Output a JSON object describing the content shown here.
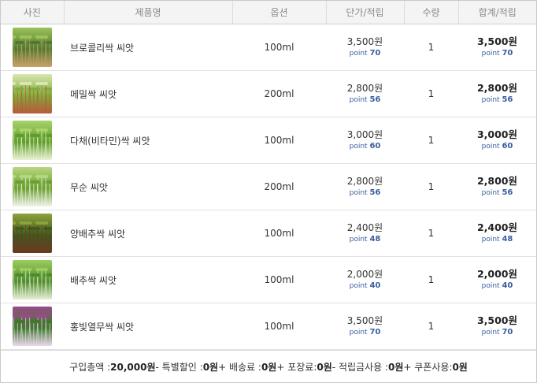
{
  "headers": {
    "photo": "사진",
    "product": "제품명",
    "option": "옵션",
    "unit_price": "단가/적립",
    "qty": "수량",
    "total": "합계/적립"
  },
  "point_label": "point",
  "rows": [
    {
      "name": "브로콜리싹 씨앗",
      "option": "100ml",
      "price": "3,500원",
      "point": "70",
      "qty": "1",
      "total": "3,500원",
      "total_point": "70",
      "thumb_icon": "broccoli-sprout-photo",
      "colors": [
        "#4f7a2e",
        "#9cc25a",
        "#c9a06b"
      ]
    },
    {
      "name": "메밀싹 씨앗",
      "option": "200ml",
      "price": "2,800원",
      "point": "56",
      "qty": "1",
      "total": "2,800원",
      "total_point": "56",
      "thumb_icon": "buckwheat-sprout-photo",
      "colors": [
        "#7fae3a",
        "#d9e6b0",
        "#b85a3a"
      ]
    },
    {
      "name": "다채(비타민)싹 씨앗",
      "option": "100ml",
      "price": "3,000원",
      "point": "60",
      "qty": "1",
      "total": "3,000원",
      "total_point": "60",
      "thumb_icon": "tatsoi-sprout-photo",
      "colors": [
        "#5e9c2a",
        "#a9d36b",
        "#eaf2d2"
      ]
    },
    {
      "name": "무순 씨앗",
      "option": "200ml",
      "price": "2,800원",
      "point": "56",
      "qty": "1",
      "total": "2,800원",
      "total_point": "56",
      "thumb_icon": "radish-sprout-photo",
      "colors": [
        "#6aa030",
        "#b7d880",
        "#f0f3e8"
      ]
    },
    {
      "name": "양배추싹 씨앗",
      "option": "100ml",
      "price": "2,400원",
      "point": "48",
      "qty": "1",
      "total": "2,400원",
      "total_point": "48",
      "thumb_icon": "cabbage-sprout-photo",
      "colors": [
        "#3f5a1e",
        "#8da23b",
        "#6b3a22"
      ]
    },
    {
      "name": "배추싹 씨앗",
      "option": "100ml",
      "price": "2,000원",
      "point": "40",
      "qty": "1",
      "total": "2,000원",
      "total_point": "40",
      "thumb_icon": "napa-cabbage-sprout-photo",
      "colors": [
        "#4e8c2a",
        "#9ccd5e",
        "#e5eed5"
      ]
    },
    {
      "name": "홍빛열무싹 씨앗",
      "option": "100ml",
      "price": "3,500원",
      "point": "70",
      "qty": "1",
      "total": "3,500원",
      "total_point": "70",
      "thumb_icon": "red-radish-sprout-photo",
      "colors": [
        "#3e7a2a",
        "#9a4a8a",
        "#e8d8ea"
      ]
    }
  ],
  "summary": {
    "purchase_label": "구입총액 : ",
    "purchase_value": "20,000원",
    "discount_label": " - 특별할인 : ",
    "discount_value": "0원",
    "shipping_label": " + 배송료 : ",
    "shipping_value": "0원",
    "packing_label": " + 포장료: ",
    "packing_value": "0원",
    "points_label": " - 적립금사용 : ",
    "points_value": "0원",
    "coupon_label": " + 쿠폰사용: ",
    "coupon_value": "0원"
  }
}
